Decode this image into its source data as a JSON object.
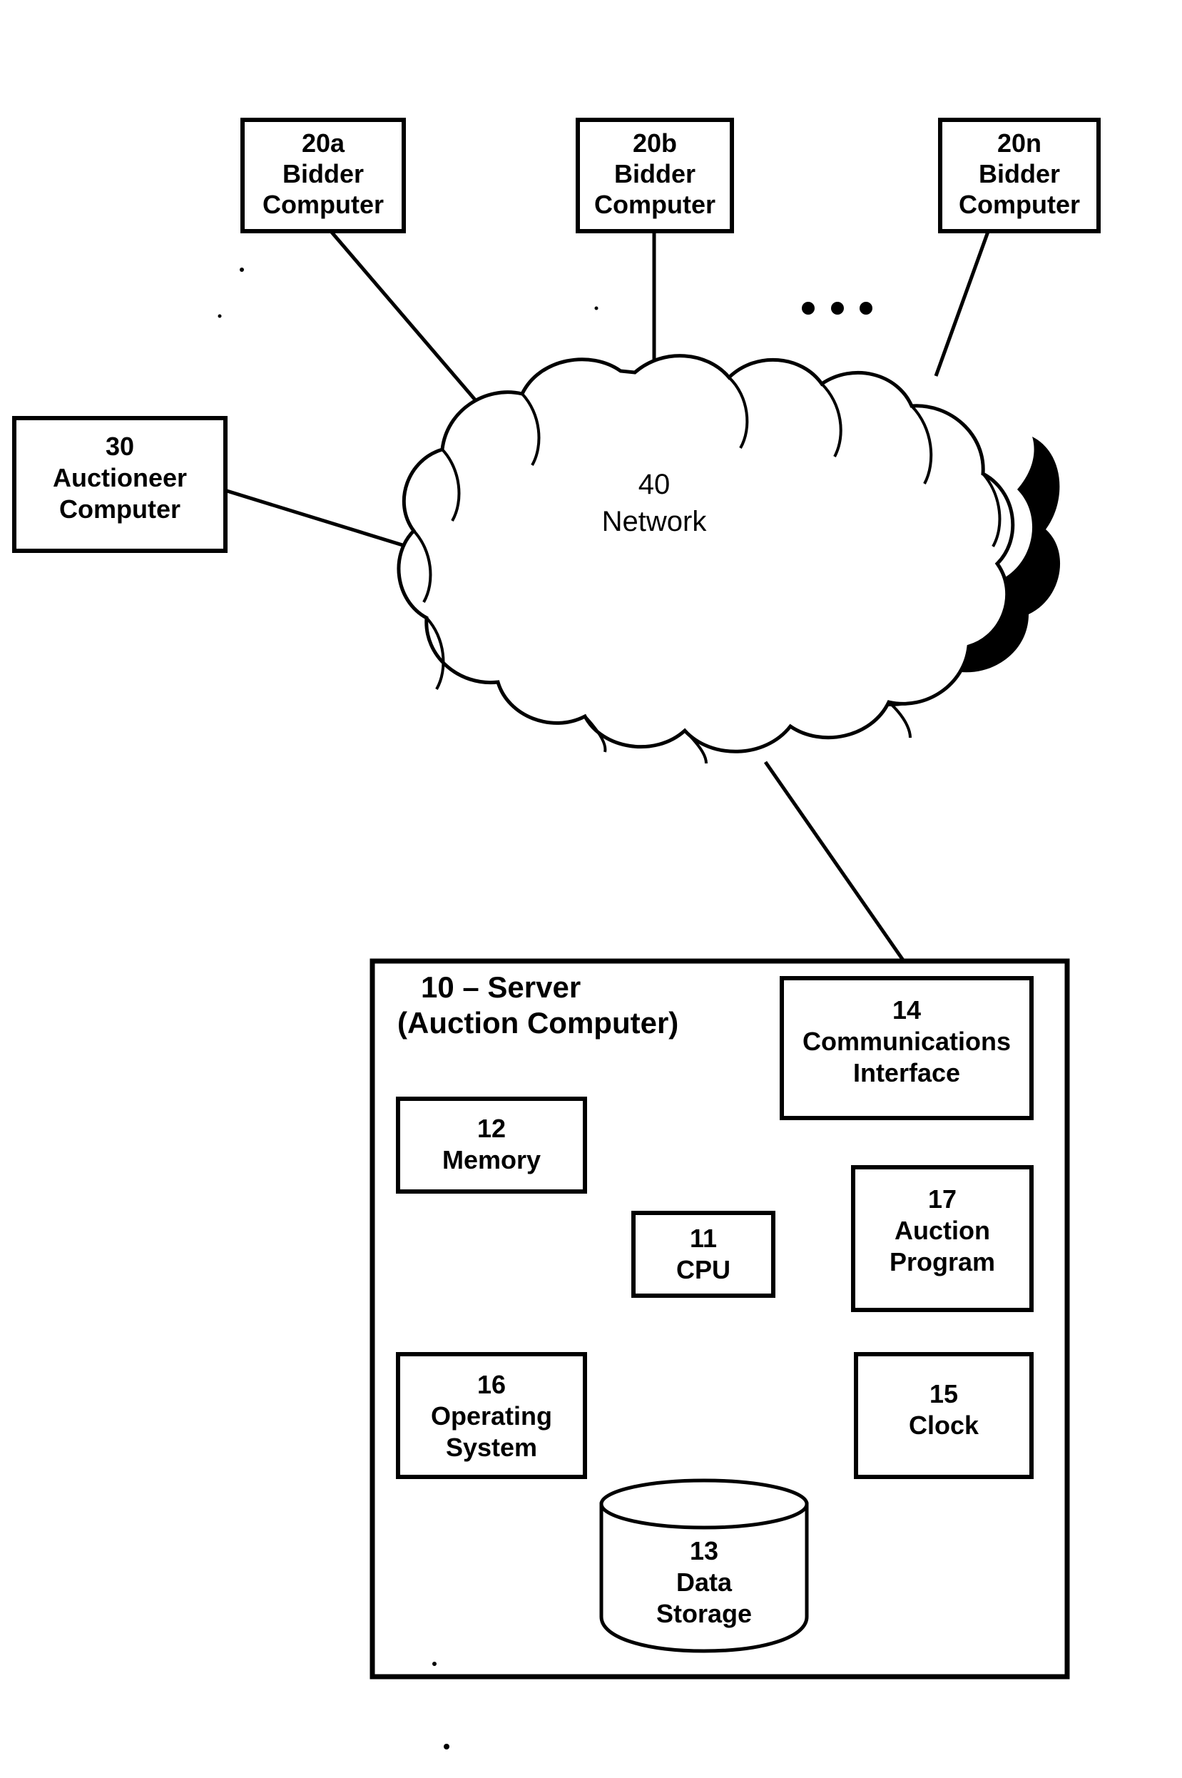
{
  "figure": {
    "type": "patent-block-diagram",
    "title": "Auction system network architecture block diagram",
    "background_color": "#ffffff",
    "line_color": "#000000"
  },
  "nodes": {
    "bidder_a": {
      "ref": "20a",
      "line1": "Bidder",
      "line2": "Computer"
    },
    "bidder_b": {
      "ref": "20b",
      "line1": "Bidder",
      "line2": "Computer"
    },
    "bidder_n": {
      "ref": "20n",
      "line1": "Bidder",
      "line2": "Computer"
    },
    "auctioneer": {
      "ref": "30",
      "line1": "Auctioneer",
      "line2": "Computer"
    },
    "network": {
      "ref": "40",
      "line1": "Network"
    },
    "server": {
      "line1": "10 – Server",
      "line2": "(Auction Computer)"
    },
    "comm_interface": {
      "ref": "14",
      "line1": "Communications",
      "line2": "Interface"
    },
    "memory": {
      "ref": "12",
      "line1": "Memory"
    },
    "cpu": {
      "ref": "11",
      "line1": "CPU"
    },
    "auction_program": {
      "ref": "17",
      "line1": "Auction",
      "line2": "Program"
    },
    "operating_system": {
      "ref": "16",
      "line1": "Operating",
      "line2": "System"
    },
    "clock": {
      "ref": "15",
      "line1": "Clock"
    },
    "data_storage": {
      "ref": "13",
      "line1": "Data",
      "line2": "Storage"
    }
  },
  "ellipsis": {
    "label": "..."
  },
  "connections": [
    {
      "from": "bidder_a",
      "to": "network"
    },
    {
      "from": "bidder_b",
      "to": "network"
    },
    {
      "from": "bidder_n",
      "to": "network"
    },
    {
      "from": "auctioneer",
      "to": "network"
    },
    {
      "from": "network",
      "to": "comm_interface"
    },
    {
      "from": "comm_interface",
      "to": "cpu"
    },
    {
      "from": "memory",
      "to": "cpu"
    },
    {
      "from": "cpu",
      "to": "auction_program"
    },
    {
      "from": "cpu",
      "to": "operating_system"
    },
    {
      "from": "cpu",
      "to": "clock"
    },
    {
      "from": "cpu",
      "to": "data_storage"
    }
  ]
}
